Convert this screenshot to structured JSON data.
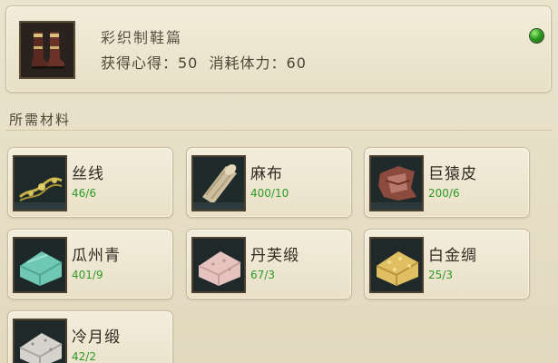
{
  "recipe": {
    "name": "彩织制鞋篇",
    "stats": "获得心得：50  消耗体力：60",
    "icon": "boots-icon",
    "status_color": "#2f9b22"
  },
  "section": {
    "title": "所需材料"
  },
  "materials": [
    {
      "name": "丝线",
      "count": "46/6",
      "icon": "thread-icon"
    },
    {
      "name": "麻布",
      "count": "400/10",
      "icon": "linen-roll-icon"
    },
    {
      "name": "巨猿皮",
      "count": "200/6",
      "icon": "ape-hide-icon"
    },
    {
      "name": "瓜州青",
      "count": "401/9",
      "icon": "teal-cloth-icon"
    },
    {
      "name": "丹芙缎",
      "count": "67/3",
      "icon": "pink-satin-icon"
    },
    {
      "name": "白金绸",
      "count": "25/3",
      "icon": "gold-silk-icon"
    },
    {
      "name": "冷月缎",
      "count": "42/2",
      "icon": "silver-satin-icon"
    }
  ],
  "colors": {
    "count_text": "#2c9a25",
    "panel_bg": "#e4dbc2"
  }
}
